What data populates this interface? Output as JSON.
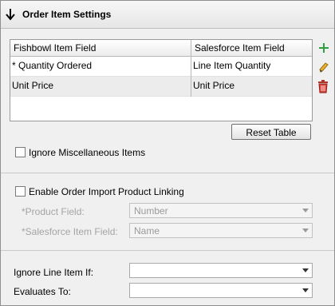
{
  "header": {
    "title": "Order Item Settings",
    "icon": "arrow-down-icon"
  },
  "table": {
    "columns": [
      "Fishbowl Item Field",
      "Salesforce Item Field"
    ],
    "rows": [
      [
        "* Quantity Ordered",
        "Line Item Quantity"
      ],
      [
        "Unit Price",
        "Unit Price"
      ]
    ]
  },
  "side_icons": [
    "add-icon",
    "edit-icon",
    "delete-icon"
  ],
  "reset_table_label": "Reset Table",
  "ignore_misc": {
    "label": "Ignore Miscellaneous Items",
    "checked": false
  },
  "product_linking": {
    "label": "Enable Order Import Product Linking",
    "checked": false,
    "product_field_label": "*Product Field:",
    "product_field_value": "Number",
    "salesforce_field_label": "*Salesforce Item Field:",
    "salesforce_field_value": "Name"
  },
  "line_item": {
    "ignore_label": "Ignore Line Item If:",
    "ignore_value": "",
    "evaluates_label": "Evaluates To:",
    "evaluates_value": ""
  },
  "colors": {
    "add": "#2e9e3e",
    "edit": "#d59a1a",
    "delete": "#c0392b"
  }
}
